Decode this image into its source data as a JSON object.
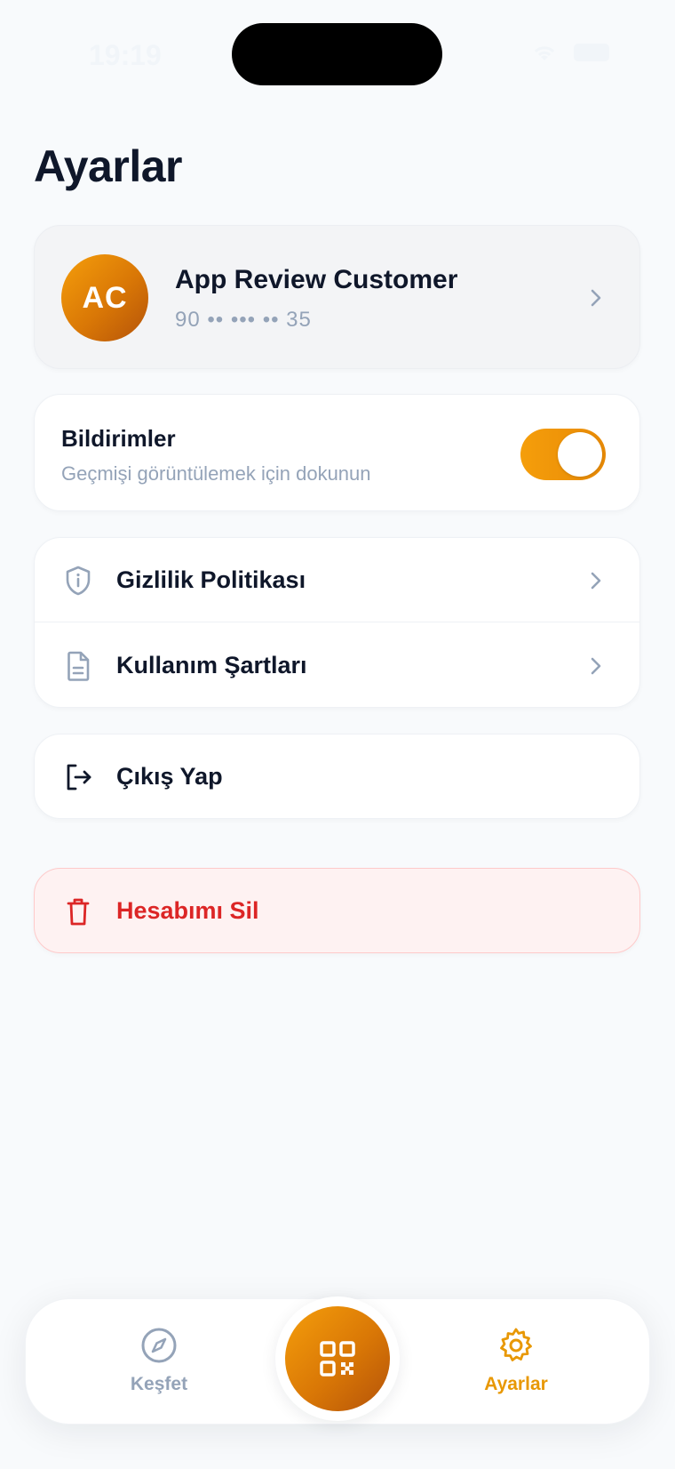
{
  "status_bar": {
    "time": "19:19"
  },
  "page": {
    "title": "Ayarlar"
  },
  "profile": {
    "initials": "AC",
    "name": "App Review Customer",
    "phone_masked": "90 •• ••• •• 35"
  },
  "notifications": {
    "title": "Bildirimler",
    "subtitle": "Geçmişi görüntülemek için dokunun",
    "enabled": true
  },
  "links": [
    {
      "label": "Gizlilik Politikası",
      "icon": "shield-info-icon"
    },
    {
      "label": "Kullanım Şartları",
      "icon": "document-icon"
    }
  ],
  "logout": {
    "label": "Çıkış Yap",
    "icon": "logout-icon"
  },
  "delete_account": {
    "label": "Hesabımı Sil",
    "icon": "trash-icon"
  },
  "tab_bar": {
    "items": [
      {
        "label": "Keşfet",
        "icon": "compass-icon",
        "active": false
      },
      {
        "label": "Ayarlar",
        "icon": "gear-icon",
        "active": true
      }
    ],
    "center_action_icon": "qr-code-icon"
  },
  "colors": {
    "accent": "#f59e0b",
    "accent_dark": "#d97706",
    "danger": "#dc2626",
    "danger_bg": "#fef2f2",
    "muted": "#94a3b8",
    "text": "#0f172a"
  }
}
